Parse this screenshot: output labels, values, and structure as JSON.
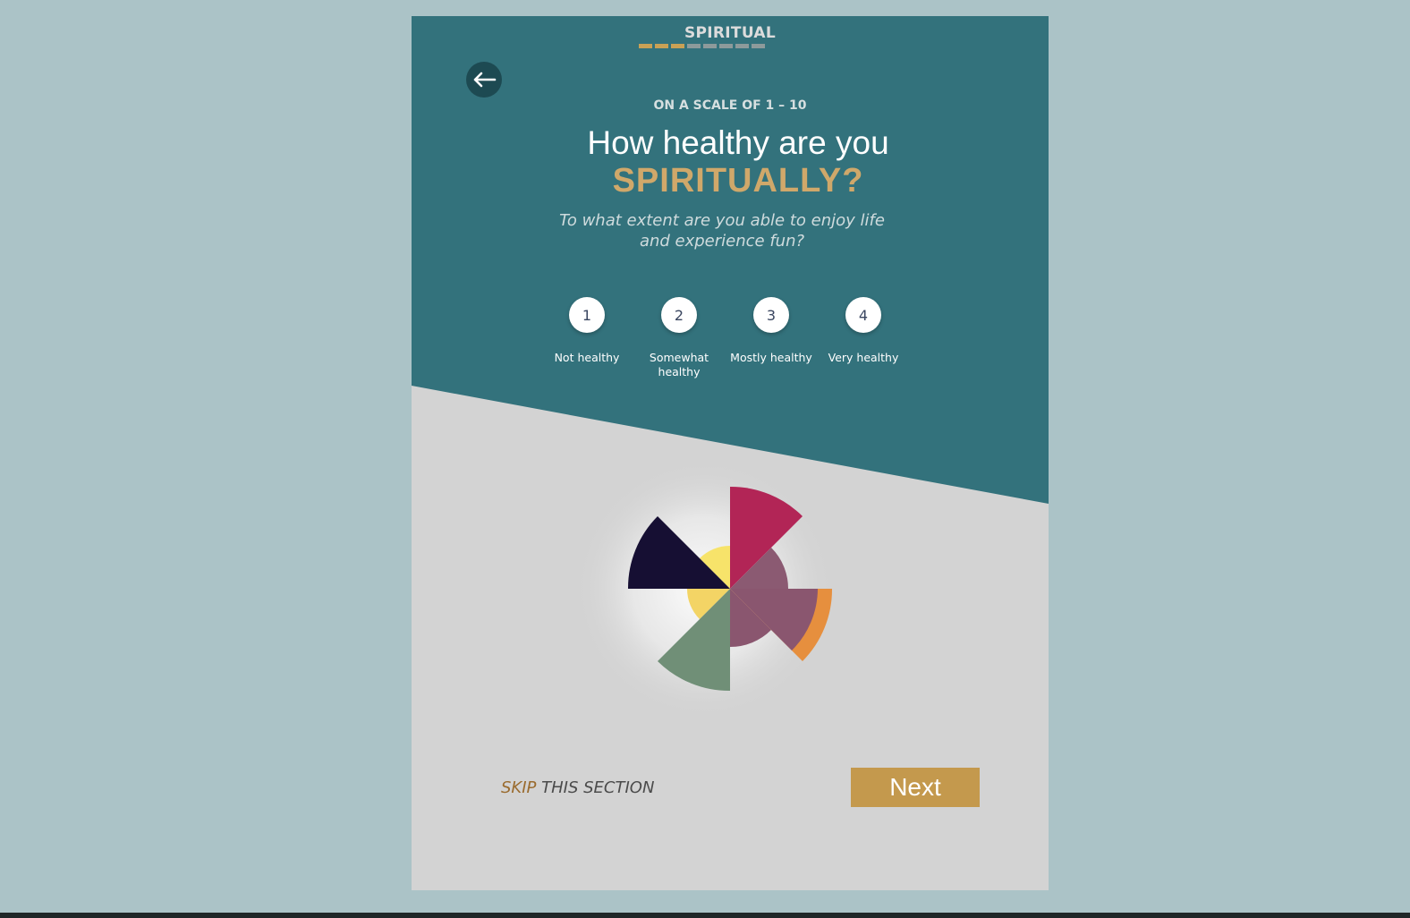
{
  "section": {
    "title": "SPIRITUAL",
    "progress_completed_steps": 3,
    "progress_total_steps": 8
  },
  "header": {
    "eyebrow": "ON A SCALE OF 1 – 10",
    "question": "How healthy are you",
    "question_accent": "SPIRITUALLY?",
    "subtitle": "To what extent are you able to enjoy life and experience fun?"
  },
  "options": [
    {
      "number": "1",
      "label": "Not healthy"
    },
    {
      "number": "2",
      "label": "Somewhat healthy"
    },
    {
      "number": "3",
      "label": "Mostly healthy"
    },
    {
      "number": "4",
      "label": "Very healthy"
    }
  ],
  "footer": {
    "skip_word": "SKIP",
    "skip_rest": " THIS SECTION",
    "next_label": "Next"
  },
  "colors": {
    "page_bg": "#abc3c7",
    "teal": "#33727c",
    "card_bg": "#d3d3d3",
    "accent_gold": "#c4994d",
    "accent_text": "#d0a86a",
    "wheel_navy": "#160f33",
    "wheel_crimson": "#b22556",
    "wheel_mauve": "#8a566f",
    "wheel_orange": "#e68f3e",
    "wheel_green": "#708f77",
    "wheel_yellow": "#f5df6b"
  },
  "icons": {
    "back": "arrow-left-icon",
    "wheel": "life-balance-wheel-icon"
  }
}
